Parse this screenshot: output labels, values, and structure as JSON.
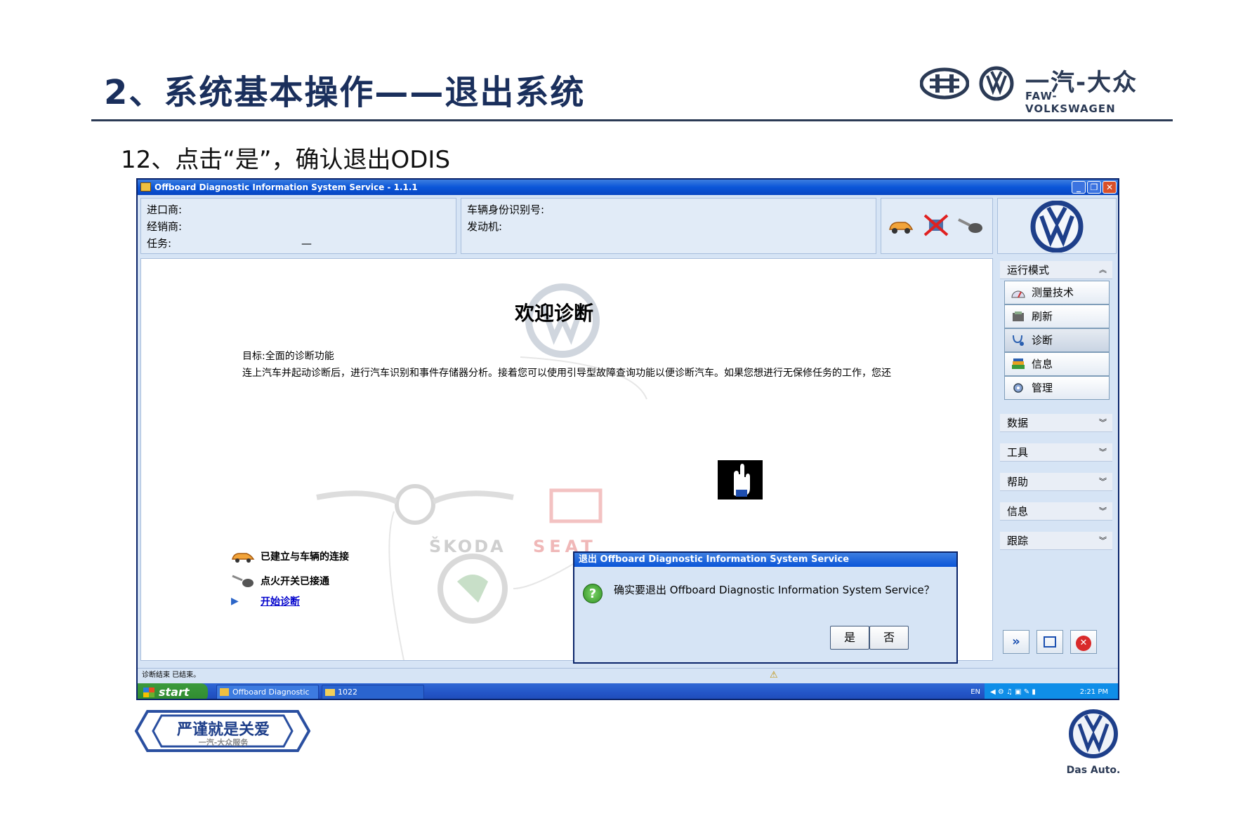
{
  "slide": {
    "title": "2、系统基本操作——退出系统",
    "step": "12、点击“是”，确认退出ODIS",
    "brand_cn": "一汽-大众",
    "brand_en": "FAW-VOLKSWAGEN",
    "badge_text": "严谨就是关爱",
    "badge_sub": "一汽-大众服务",
    "das_auto": "Das Auto."
  },
  "window": {
    "title": "Offboard Diagnostic Information System Service - 1.1.1",
    "info_left": {
      "importer": "进口商:",
      "dealer": "经销商:",
      "task": "任务:",
      "task_value": "—"
    },
    "info_mid": {
      "vin": "车辆身份识别号:",
      "engine": "发动机:"
    },
    "main": {
      "welcome": "欢迎诊断",
      "goal": "目标:全面的诊断功能",
      "paragraph": "连上汽车并起动诊断后，进行汽车识别和事件存储器分析。接着您可以使用引导型故障查询功能以便诊断汽车。如果您想进行无保修任务的工作，您还",
      "status_connected": "已建立与车辆的连接",
      "status_ignition": "点火开关已接通",
      "start_link": "开始诊断",
      "brand_skoda": "ŠKODA",
      "brand_seat": "SEAT"
    },
    "sidebar": {
      "section_mode": "运行模式",
      "buttons": [
        {
          "label": "测量技术"
        },
        {
          "label": "刷新"
        },
        {
          "label": "诊断"
        },
        {
          "label": "信息"
        },
        {
          "label": "管理"
        }
      ],
      "sections": [
        "数据",
        "工具",
        "帮助",
        "信息",
        "跟踪"
      ]
    },
    "status_bar": "诊断结束 已结束。",
    "taskbar": {
      "start": "start",
      "task1": "Offboard Diagnostic I...",
      "task2": "1022",
      "lang": "EN",
      "clock": "2:21 PM"
    },
    "dialog": {
      "title": "退出 Offboard Diagnostic Information System Service",
      "message": "确实要退出 Offboard Diagnostic Information System Service？",
      "yes": "是",
      "no": "否"
    }
  }
}
